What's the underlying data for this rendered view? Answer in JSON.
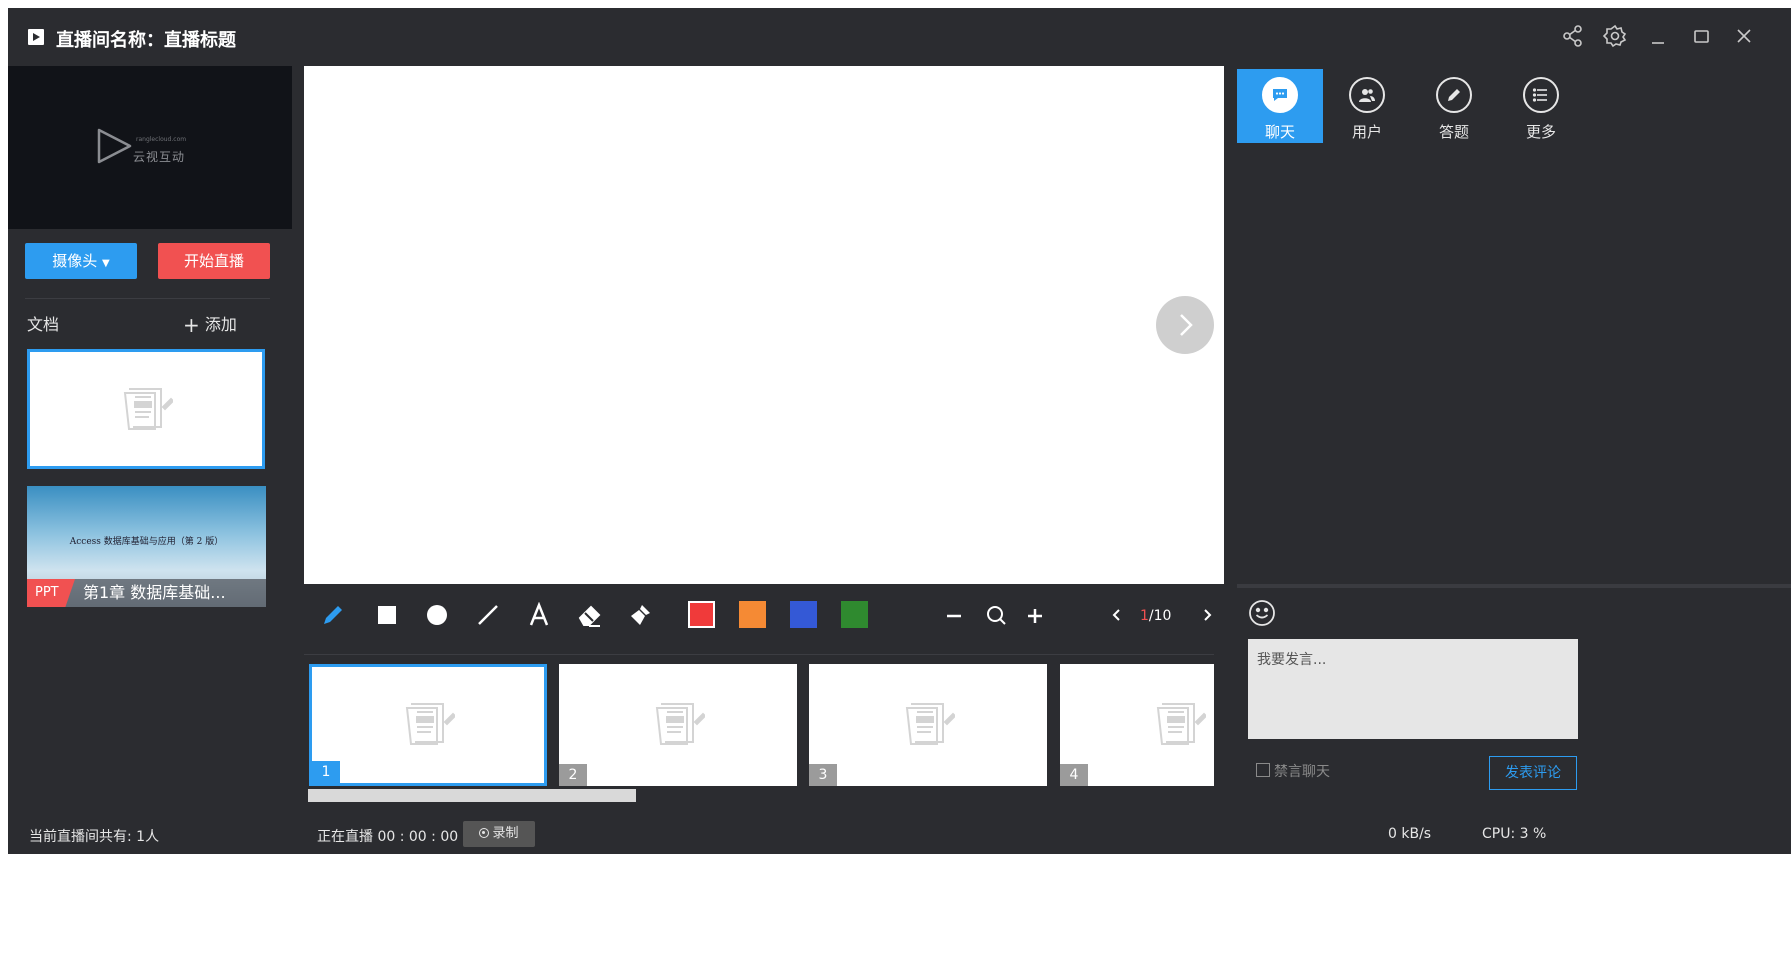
{
  "window": {
    "title": "直播间名称：直播标题",
    "icons": [
      "share-icon",
      "settings-icon",
      "minimize-icon",
      "maximize-icon",
      "close-icon"
    ]
  },
  "left_panel": {
    "logo_small": "ranglecloud.com",
    "logo_main": "云视互动",
    "camera_button": "摄像头",
    "live_button": "开始直播",
    "docs_label": "文档",
    "add_label": "添加",
    "ppt": {
      "slide_title": "Access 数据库基础与应用（第 2 版）",
      "tag": "PPT",
      "name": "第1章  数据库基础..."
    }
  },
  "toolbar": {
    "tools": [
      "pen-icon",
      "rectangle-icon",
      "circle-icon",
      "line-icon",
      "text-icon",
      "eraser-icon",
      "clear-icon"
    ],
    "colors": [
      "#f03a3a",
      "#f58a34",
      "#3459d6",
      "#2f8a2f"
    ],
    "page_current": "1",
    "page_total": "/10",
    "zoom": [
      "zoom-out-icon",
      "zoom-icon",
      "zoom-in-icon"
    ]
  },
  "thumbnails": {
    "pages": [
      "1",
      "2",
      "3",
      "4"
    ],
    "active": 0
  },
  "right_panel": {
    "tabs": [
      {
        "label": "聊天",
        "icon": "chat-icon",
        "active": true
      },
      {
        "label": "用户",
        "icon": "users-icon",
        "active": false
      },
      {
        "label": "答题",
        "icon": "pencil-icon",
        "active": false
      },
      {
        "label": "更多",
        "icon": "menu-icon",
        "active": false
      }
    ],
    "input_placeholder": "我要发言...",
    "ban_label": "禁言聊天",
    "post_button": "发表评论"
  },
  "status": {
    "viewers": "当前直播间共有: 1人",
    "live": "正在直播 00 : 00 : 00",
    "record": "录制",
    "speed": "0 kB/s",
    "cpu": "CPU:  3 %"
  },
  "colors": {
    "accent": "#2d9cf0",
    "danger": "#f15151",
    "background": "#2b2c30"
  }
}
